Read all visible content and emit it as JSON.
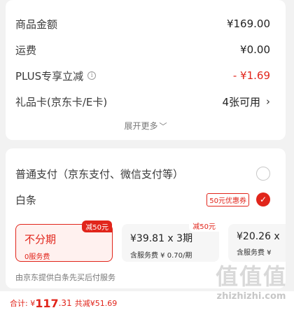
{
  "summary": {
    "rows": [
      {
        "label": "商品金额",
        "value": "¥169.00"
      },
      {
        "label": "运费",
        "value": "¥0.00"
      },
      {
        "label": "PLUS专享立减",
        "value": "- ¥1.69",
        "info_icon": "i"
      },
      {
        "label": "礼品卡(京东卡/E卡)",
        "value": "4张可用",
        "chevron": "›"
      }
    ],
    "expand_label": "展开更多",
    "expand_chevron": "﹀"
  },
  "payment": {
    "options": [
      {
        "label": "普通支付（京东支付、微信支付等）",
        "selected": false
      },
      {
        "label": "白条",
        "selected": true,
        "coupon": "50元优惠券",
        "check": "✓"
      }
    ],
    "plans": [
      {
        "main": "不分期",
        "sub": "0服务费",
        "badge": "减50元",
        "selected": true
      },
      {
        "main": "¥39.81 x 3期",
        "sub": "含服务费 ¥ 0.70/期",
        "badge": "减50元",
        "selected": false
      },
      {
        "main": "¥20.26 x",
        "sub": "含服务费 ¥",
        "selected": false
      }
    ],
    "provider_note": "由京东提供白条先买后付服务"
  },
  "footer": {
    "total_prefix": "合计: ¥",
    "total_int": "117",
    "total_dec": ".31",
    "saved": "共减¥51.69"
  },
  "watermark": {
    "glyphs": "值值值",
    "site": "zhizhizhi.com"
  },
  "colors": {
    "accent": "#e1251b",
    "background": "#f2f2f2"
  }
}
